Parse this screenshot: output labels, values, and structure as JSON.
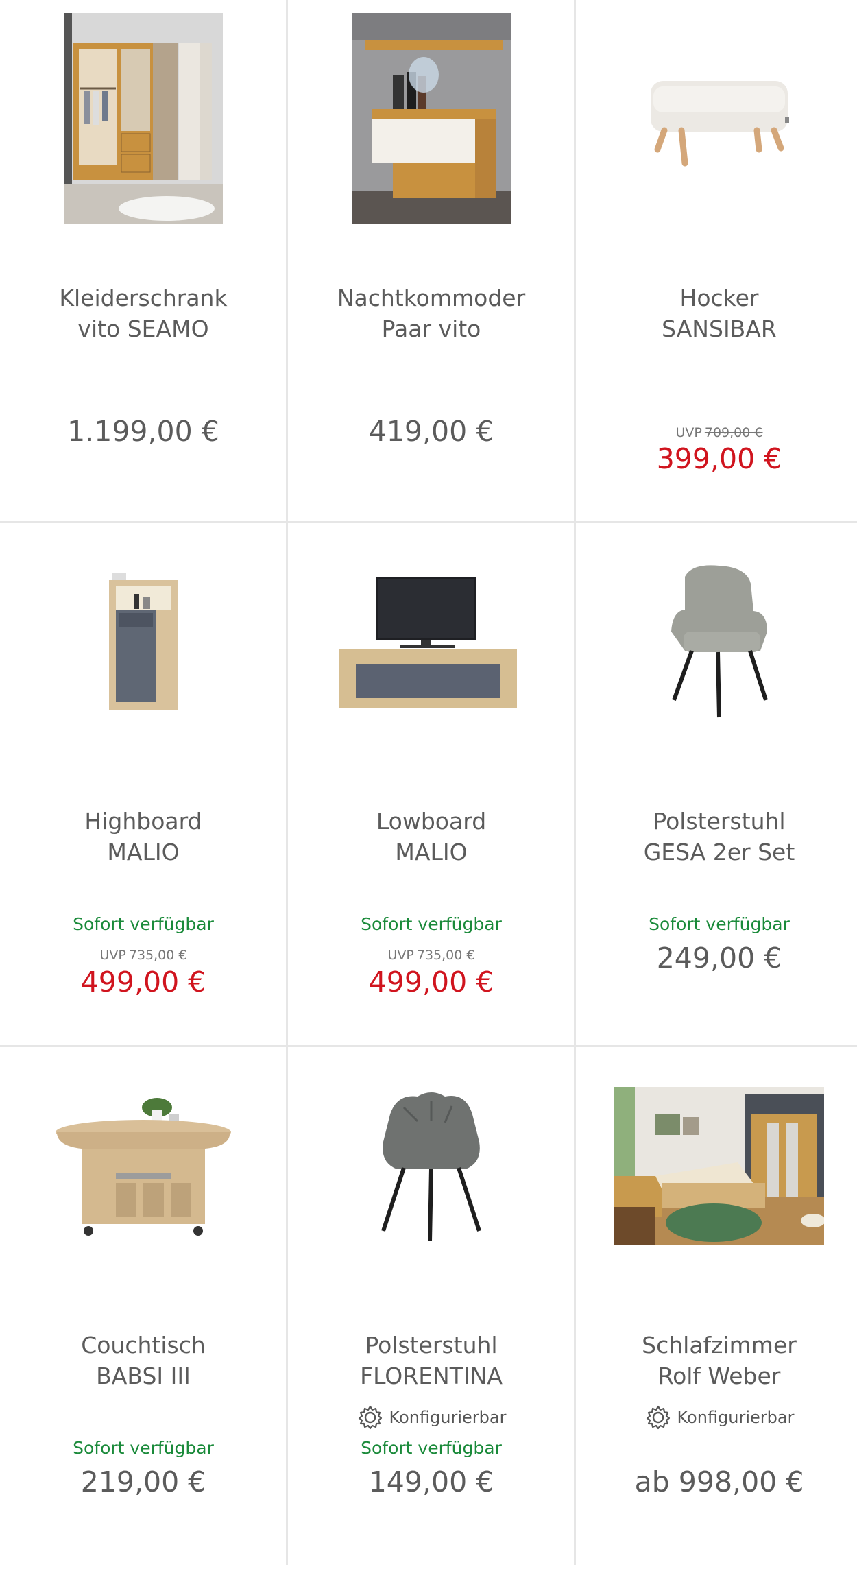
{
  "products": [
    {
      "name_line1": "Kleiderschrank",
      "name_line2": "vito SEAMO",
      "configurable": "",
      "availability": "",
      "uvp_label": "",
      "uvp_price": "",
      "price": "1.199,00 €",
      "sale": false,
      "image": "wardrobe-photo"
    },
    {
      "name_line1": "Nachtkommoder",
      "name_line2": "Paar vito",
      "configurable": "",
      "availability": "",
      "uvp_label": "",
      "uvp_price": "",
      "price": "419,00 €",
      "sale": false,
      "image": "nightstand-photo"
    },
    {
      "name_line1": "Hocker",
      "name_line2": "SANSIBAR",
      "configurable": "",
      "availability": "",
      "uvp_label": "UVP",
      "uvp_price": "709,00 €",
      "price": "399,00 €",
      "sale": true,
      "image": "ottoman-photo"
    },
    {
      "name_line1": "Highboard",
      "name_line2": "MALIO",
      "configurable": "",
      "availability": "Sofort verfügbar",
      "uvp_label": "UVP",
      "uvp_price": "735,00 €",
      "price": "499,00 €",
      "sale": true,
      "image": "highboard-photo"
    },
    {
      "name_line1": "Lowboard",
      "name_line2": "MALIO",
      "configurable": "",
      "availability": "Sofort verfügbar",
      "uvp_label": "UVP",
      "uvp_price": "735,00 €",
      "price": "499,00 €",
      "sale": true,
      "image": "lowboard-photo"
    },
    {
      "name_line1": "Polsterstuhl",
      "name_line2": "GESA 2er Set",
      "configurable": "",
      "availability": "Sofort verfügbar",
      "uvp_label": "",
      "uvp_price": "",
      "price": "249,00 €",
      "sale": false,
      "image": "chair-gesa-photo"
    },
    {
      "name_line1": "Couchtisch",
      "name_line2": "BABSI III",
      "configurable": "",
      "availability": "Sofort verfügbar",
      "uvp_label": "",
      "uvp_price": "",
      "price": "219,00 €",
      "sale": false,
      "image": "coffee-table-photo"
    },
    {
      "name_line1": "Polsterstuhl",
      "name_line2": "FLORENTINA",
      "configurable": "Konfigurierbar",
      "availability": "Sofort verfügbar",
      "uvp_label": "",
      "uvp_price": "",
      "price": "149,00 €",
      "sale": false,
      "image": "chair-florentina-photo"
    },
    {
      "name_line1": "Schlafzimmer",
      "name_line2": "Rolf Weber",
      "configurable": "Konfigurierbar",
      "availability": "",
      "uvp_label": "",
      "uvp_price": "",
      "price": "ab 998,00 €",
      "sale": false,
      "image": "bedroom-photo"
    }
  ],
  "colors": {
    "sale_price": "#d0141e",
    "availability": "#1a8a3a",
    "divider": "#e6e6e6"
  }
}
